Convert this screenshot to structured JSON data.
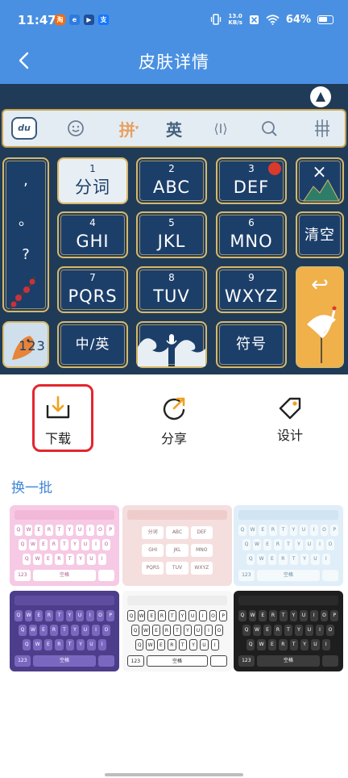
{
  "status_bar": {
    "time": "11:47",
    "net_speed_value": "13.0",
    "net_speed_unit": "KB/s",
    "battery": "64%",
    "app_icons": [
      {
        "name": "taobao-app-icon",
        "glyph": "淘",
        "color": "#ff6a00"
      },
      {
        "name": "browser-app-icon",
        "glyph": "e",
        "color": "#2d7be0"
      },
      {
        "name": "video-app-icon",
        "glyph": "▶",
        "color": "#1f4f9a"
      },
      {
        "name": "alipay-app-icon",
        "glyph": "支",
        "color": "#1677ff"
      }
    ]
  },
  "nav": {
    "back_icon": "chevron-left-icon",
    "title": "皮肤详情"
  },
  "keyboard_preview": {
    "toolbar": {
      "logo": "du",
      "pinyin": "拼",
      "english": "英",
      "cursor": "⟨I⟩",
      "search": "search-icon",
      "emoji": "smile-icon"
    },
    "punct": [
      ",",
      "。",
      "?"
    ],
    "keys": [
      {
        "name": "key-1",
        "num": "1",
        "label": "分词"
      },
      {
        "name": "key-2",
        "num": "2",
        "label": "ABC"
      },
      {
        "name": "key-3",
        "num": "3",
        "label": "DEF"
      },
      {
        "name": "key-4",
        "num": "4",
        "label": "GHI"
      },
      {
        "name": "key-5",
        "num": "5",
        "label": "JKL"
      },
      {
        "name": "key-6",
        "num": "6",
        "label": "MNO"
      },
      {
        "name": "key-7",
        "num": "7",
        "label": "PQRS"
      },
      {
        "name": "key-8",
        "num": "8",
        "label": "TUV"
      },
      {
        "name": "key-9",
        "num": "9",
        "label": "WXYZ"
      }
    ],
    "delete": "×",
    "clear": "清空",
    "enter": "↩",
    "num_toggle": "123",
    "lang_toggle": "中/英",
    "symbols": "符号"
  },
  "actions": {
    "download": "下载",
    "share": "分享",
    "design": "设计"
  },
  "gallery": {
    "title": "换一批",
    "thumb_row_keys": [
      "Q",
      "W",
      "E",
      "R",
      "T",
      "Y",
      "U",
      "I",
      "O",
      "P"
    ],
    "thumb_nine_keys": [
      "分词",
      "ABC",
      "DEF",
      "GHI",
      "JKL",
      "MNO",
      "PQRS",
      "TUV",
      "WXYZ"
    ],
    "thumb_space_label": "空格",
    "thumb_num_label": "123"
  }
}
